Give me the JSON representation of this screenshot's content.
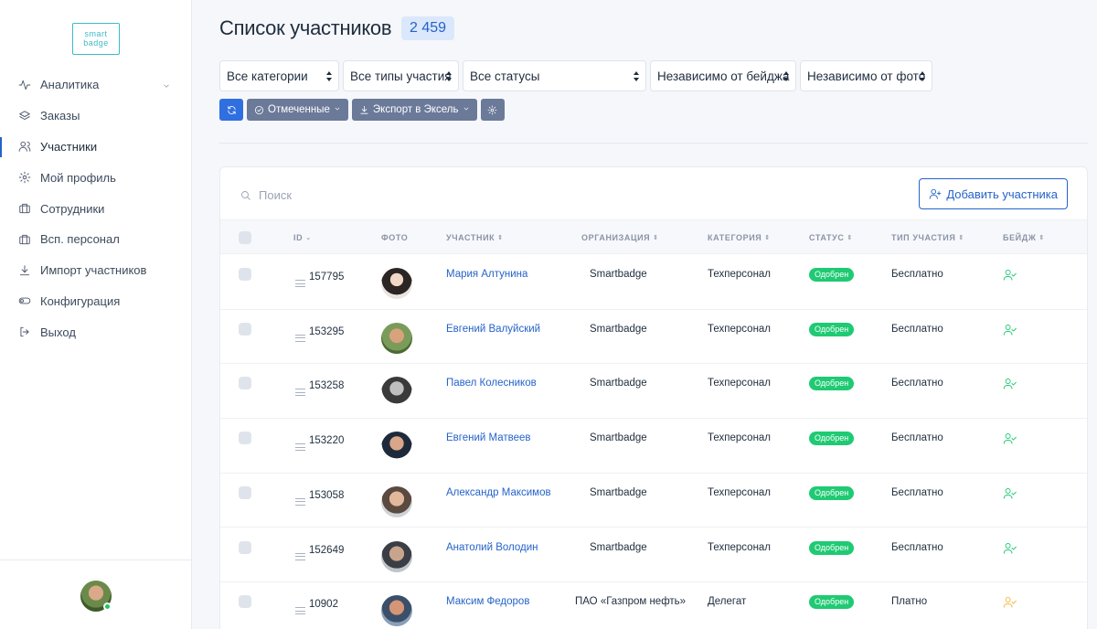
{
  "sidebar": {
    "logo_line1": "smart",
    "logo_line2": "badge",
    "items": [
      {
        "label": "Аналитика",
        "icon": "activity-icon",
        "has_chevron": true
      },
      {
        "label": "Заказы",
        "icon": "layers-icon"
      },
      {
        "label": "Участники",
        "icon": "users-icon",
        "active": true
      },
      {
        "label": "Мой профиль",
        "icon": "gear-icon"
      },
      {
        "label": "Сотрудники",
        "icon": "briefcase-icon"
      },
      {
        "label": "Всп. персонал",
        "icon": "briefcase-icon"
      },
      {
        "label": "Импорт участников",
        "icon": "download-icon"
      },
      {
        "label": "Конфигурация",
        "icon": "toggle-icon"
      },
      {
        "label": "Выход",
        "icon": "logout-icon"
      }
    ]
  },
  "header": {
    "title": "Список участников",
    "count": "2 459"
  },
  "filters": [
    {
      "label": "Все категории",
      "width": 131
    },
    {
      "label": "Все типы участия",
      "width": 127
    },
    {
      "label": "Все статусы",
      "width": 201
    },
    {
      "label": "Независимо от бейджа",
      "width": 160
    },
    {
      "label": "Независимо от фото",
      "width": 145
    }
  ],
  "toolbar": {
    "marked_label": "Отмеченные",
    "export_label": "Экспорт в Эксель"
  },
  "search": {
    "placeholder": "Поиск",
    "value": ""
  },
  "add_button_label": "Добавить участника",
  "table": {
    "columns": [
      "ID",
      "ФОТО",
      "УЧАСТНИК",
      "ОРГАНИЗАЦИЯ",
      "КАТЕГОРИЯ",
      "СТАТУС",
      "ТИП УЧАСТИЯ",
      "БЕЙДЖ"
    ],
    "rows": [
      {
        "id": "157795",
        "name": "Мария Алтунина",
        "org": "Smartbadge",
        "category": "Техперсонал",
        "status": "Одобрен",
        "type": "Бесплатно",
        "badge_color": "#1fca73"
      },
      {
        "id": "153295",
        "name": "Евгений Валуйский",
        "org": "Smartbadge",
        "category": "Техперсонал",
        "status": "Одобрен",
        "type": "Бесплатно",
        "badge_color": "#1fca73"
      },
      {
        "id": "153258",
        "name": "Павел Колесников",
        "org": "Smartbadge",
        "category": "Техперсонал",
        "status": "Одобрен",
        "type": "Бесплатно",
        "badge_color": "#1fca73"
      },
      {
        "id": "153220",
        "name": "Евгений Матвеев",
        "org": "Smartbadge",
        "category": "Техперсонал",
        "status": "Одобрен",
        "type": "Бесплатно",
        "badge_color": "#1fca73"
      },
      {
        "id": "153058",
        "name": "Александр Максимов",
        "org": "Smartbadge",
        "category": "Техперсонал",
        "status": "Одобрен",
        "type": "Бесплатно",
        "badge_color": "#1fca73"
      },
      {
        "id": "152649",
        "name": "Анатолий Володин",
        "org": "Smartbadge",
        "category": "Техперсонал",
        "status": "Одобрен",
        "type": "Бесплатно",
        "badge_color": "#1fca73"
      },
      {
        "id": "10902",
        "name": "Максим Федоров",
        "org": "ПАО «Газпром нефть»",
        "category": "Делегат",
        "status": "Одобрен",
        "type": "Платно",
        "badge_color": "#f5b73b"
      }
    ]
  },
  "colors": {
    "accent": "#2563c9",
    "status_approved": "#1fca73",
    "badge_warning": "#f5b73b"
  }
}
